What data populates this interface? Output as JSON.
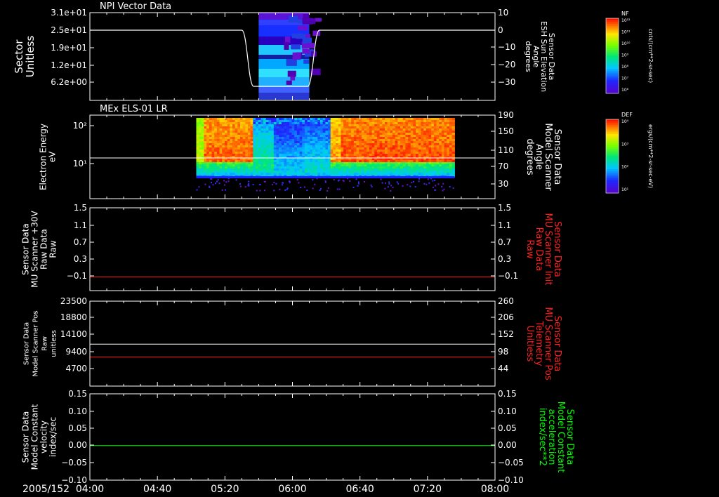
{
  "date_label": "2005/152",
  "time_ticks": [
    "04:00",
    "04:40",
    "05:20",
    "06:00",
    "06:40",
    "07:20",
    "08:00"
  ],
  "colors": {
    "background": "#000000",
    "axis": "#ffffff",
    "red_trace": "#ff2020",
    "green_trace": "#00ff00"
  },
  "panels": [
    {
      "id": "npi",
      "title": "NPI Vector Data",
      "left_label": [
        "Sector",
        "Unitless"
      ],
      "left_ticks": [
        "3.1e+01",
        "2.5e+01",
        "1.9e+01",
        "1.2e+01",
        "6.2e+00"
      ],
      "right_label": [
        "Sensor Data",
        "ESH Sun Elevation",
        "Angle",
        "degrees"
      ],
      "right_ticks": [
        "10",
        "0",
        "−10",
        "−20",
        "−30"
      ],
      "colorbar": {
        "tag": "NF",
        "top_label": "10¹²",
        "ticks": [
          "10¹²",
          "10¹¹",
          "10¹⁰",
          "10⁹",
          "10⁸",
          "10⁷",
          "10⁶"
        ],
        "units": "cnts/(cm**2-sr-sec)"
      }
    },
    {
      "id": "els",
      "title": "MEx ELS-01 LR",
      "left_label": [
        "Electron Energy",
        "eV"
      ],
      "left_ticks": [
        "10²",
        "10¹"
      ],
      "right_label": [
        "Sensor Data",
        "Model Scanner",
        "Angle",
        "degrees"
      ],
      "right_ticks": [
        "190",
        "150",
        "110",
        "70",
        "30"
      ],
      "colorbar": {
        "tag": "DEF",
        "ticks": [
          "10⁴",
          "10³",
          "10²",
          "10¹"
        ],
        "units": "ergs/(cm**2-sr-sec-eV)"
      }
    },
    {
      "id": "mu_raw",
      "left_label": [
        "Sensor Data",
        "MU Scanner +30V",
        "Raw Data",
        "Raw"
      ],
      "left_ticks": [
        "1.5",
        "1.1",
        "0.7",
        "0.3",
        "−0.1"
      ],
      "right_label": [
        "Sensor Data",
        "MU Scanner Init",
        "Raw Data",
        "Raw"
      ],
      "right_ticks": [
        "1.5",
        "1.1",
        "0.7",
        "0.3",
        "−0.1"
      ]
    },
    {
      "id": "pos",
      "left_label": [
        "Sensor Data",
        "Model Scanner Pos",
        "Raw",
        "unitless"
      ],
      "left_ticks": [
        "23500",
        "18800",
        "14100",
        "9400",
        "4700"
      ],
      "right_label": [
        "Sensor Data",
        "MU Scanner Pos",
        "Telemetry",
        "Unitless"
      ],
      "right_ticks": [
        "260",
        "206",
        "152",
        "98",
        "44"
      ]
    },
    {
      "id": "const",
      "left_label": [
        "Sensor Data",
        "Model Constant",
        "velocity",
        "index/sec"
      ],
      "left_ticks": [
        "0.15",
        "0.10",
        "0.05",
        "0.00",
        "−0.05",
        "−0.10"
      ],
      "right_label": [
        "Sensor Data",
        "Model Constant",
        "acceleration",
        "index/sec**2"
      ],
      "right_ticks": [
        "0.15",
        "0.10",
        "0.05",
        "0.00",
        "−0.05",
        "−0.10"
      ]
    }
  ],
  "chart_data": [
    {
      "type": "heatmap",
      "title": "NPI Vector Data",
      "ylabel": "Sector Unitless",
      "y2label": "Sensor Data ESH Sun Elevation Angle degrees",
      "x_range": [
        "04:00",
        "08:00"
      ],
      "heatmap_time_span": [
        "05:40",
        "06:10"
      ],
      "overlay_series": {
        "name": "Sensor Data ESH Sun Elevation Angle",
        "x": [
          "04:00",
          "05:30",
          "05:37",
          "06:09",
          "06:16",
          "08:00"
        ],
        "y": [
          0,
          0,
          -32,
          -32,
          0,
          0
        ]
      },
      "y2lim": [
        -40,
        10
      ],
      "colorscale_label": "cnts/(cm**2-sr-sec)"
    },
    {
      "type": "heatmap",
      "title": "MEx ELS-01 LR",
      "ylabel": "Electron Energy eV",
      "yscale": "log",
      "y2label": "Sensor Data Model Scanner Angle degrees",
      "x_range": [
        "04:00",
        "08:00"
      ],
      "heatmap_time_span": [
        "05:03",
        "07:36"
      ],
      "overlay_series": {
        "name": "Sensor Data Model Scanner Angle",
        "x": [
          "04:00",
          "08:00"
        ],
        "y": [
          100,
          100
        ]
      },
      "y2lim": [
        10,
        190
      ],
      "colorscale_label": "ergs/(cm**2-sr-sec-eV)"
    },
    {
      "type": "line",
      "ylabel": "Sensor Data MU Scanner +30V Raw Data Raw",
      "y2label": "Sensor Data MU Scanner Init Raw Data Raw",
      "x_range": [
        "04:00",
        "08:00"
      ],
      "ylim": [
        -0.3,
        1.5
      ],
      "series": [
        {
          "name": "Sensor Data MU Scanner Init Raw Data Raw",
          "color": "#ff2020",
          "x": [
            "04:00",
            "08:00"
          ],
          "y": [
            0.0,
            0.0
          ]
        }
      ]
    },
    {
      "type": "line",
      "ylabel": "Sensor Data Model Scanner Pos Raw unitless",
      "y2label": "Sensor Data MU Scanner Pos Telemetry Unitless",
      "x_range": [
        "04:00",
        "08:00"
      ],
      "ylim": [
        0,
        23500
      ],
      "y2lim": [
        260,
        17
      ],
      "series": [
        {
          "name": "Sensor Data Model Scanner Pos Raw unitless",
          "color": "#ffffff",
          "x": [
            "04:00",
            "08:00"
          ],
          "y": [
            11600,
            11600
          ]
        },
        {
          "name": "Sensor Data MU Scanner Pos Telemetry Unitless",
          "color": "#ff2020",
          "x": [
            "04:00",
            "08:00"
          ],
          "y2": [
            100,
            100
          ]
        }
      ]
    },
    {
      "type": "line",
      "ylabel": "Sensor Data Model Constant velocity index/sec",
      "y2label": "Sensor Data Model Constant acceleration index/sec**2",
      "x_range": [
        "04:00",
        "08:00"
      ],
      "ylim": [
        -0.1,
        0.15
      ],
      "series": [
        {
          "name": "Sensor Data Model Constant acceleration index/sec**2",
          "color": "#00ff00",
          "x": [
            "04:00",
            "08:00"
          ],
          "y": [
            0.0,
            0.0
          ]
        }
      ]
    }
  ]
}
